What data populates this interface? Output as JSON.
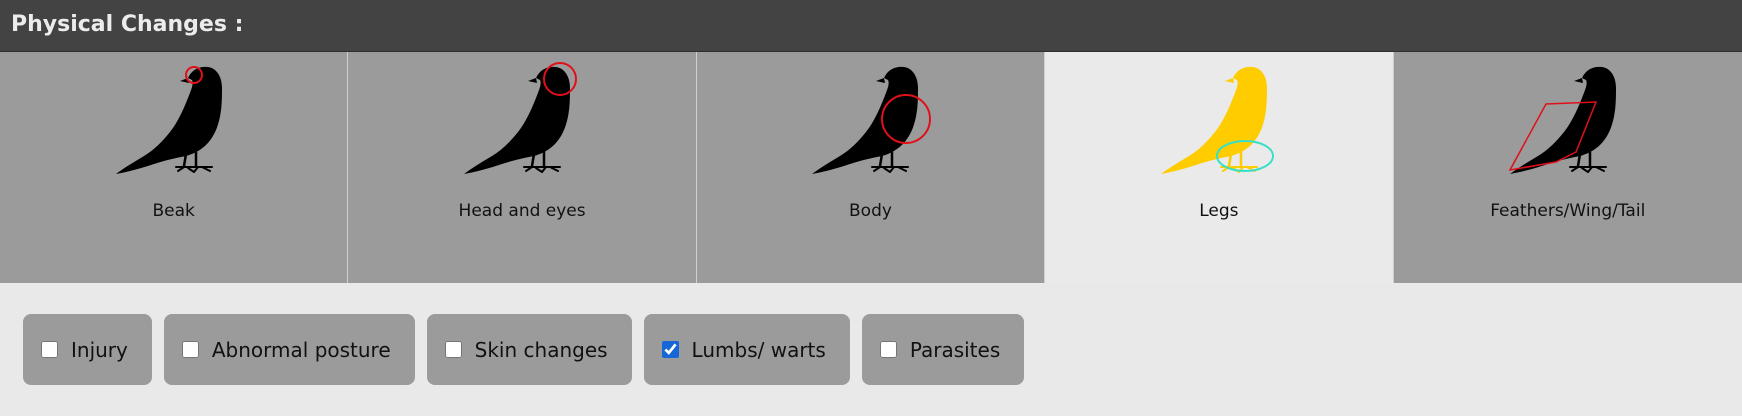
{
  "header": {
    "title": "Physical Changes :"
  },
  "tabs": [
    {
      "label": "Beak",
      "icon": "crow-beak-icon",
      "selected": false
    },
    {
      "label": "Head and eyes",
      "icon": "crow-head-icon",
      "selected": false
    },
    {
      "label": "Body",
      "icon": "crow-body-icon",
      "selected": false
    },
    {
      "label": "Legs",
      "icon": "crow-legs-icon",
      "selected": true
    },
    {
      "label": "Feathers/Wing/Tail",
      "icon": "crow-feathers-icon",
      "selected": false
    }
  ],
  "options": [
    {
      "label": "Injury",
      "checked": false
    },
    {
      "label": "Abnormal posture",
      "checked": false
    },
    {
      "label": "Skin changes",
      "checked": false
    },
    {
      "label": "Lumbs/ warts",
      "checked": true
    },
    {
      "label": "Parasites",
      "checked": false
    }
  ],
  "colors": {
    "header_bg": "#434343",
    "tab_bg": "#9b9b9b",
    "tab_selected_bg": "#eaeaea",
    "bird_default": "#000000",
    "bird_selected": "#ffcc00",
    "highlight_red": "#e0101a",
    "highlight_cyan": "#35e0c8",
    "checkbox_accent": "#1566d6"
  }
}
